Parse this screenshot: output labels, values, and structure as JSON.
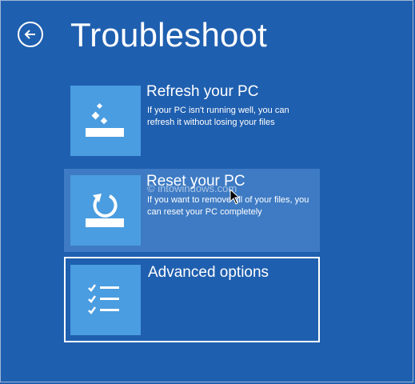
{
  "header": {
    "title": "Troubleshoot",
    "back_icon": "back-arrow-icon"
  },
  "options": [
    {
      "heading": "Refresh your PC",
      "description": "If your PC isn't running well, you can refresh it without losing your files",
      "icon": "refresh-pc-icon"
    },
    {
      "heading": "Reset your PC",
      "description": "If you want to remove all of your files, you can reset your PC completely",
      "icon": "reset-pc-icon"
    },
    {
      "heading": "Advanced options",
      "description": "",
      "icon": "checklist-icon"
    }
  ],
  "watermark": "© intowindows.com",
  "colors": {
    "background": "#1f5faf",
    "tile": "#4a9de0",
    "hover": "#3e7bc4",
    "text": "#ffffff"
  }
}
